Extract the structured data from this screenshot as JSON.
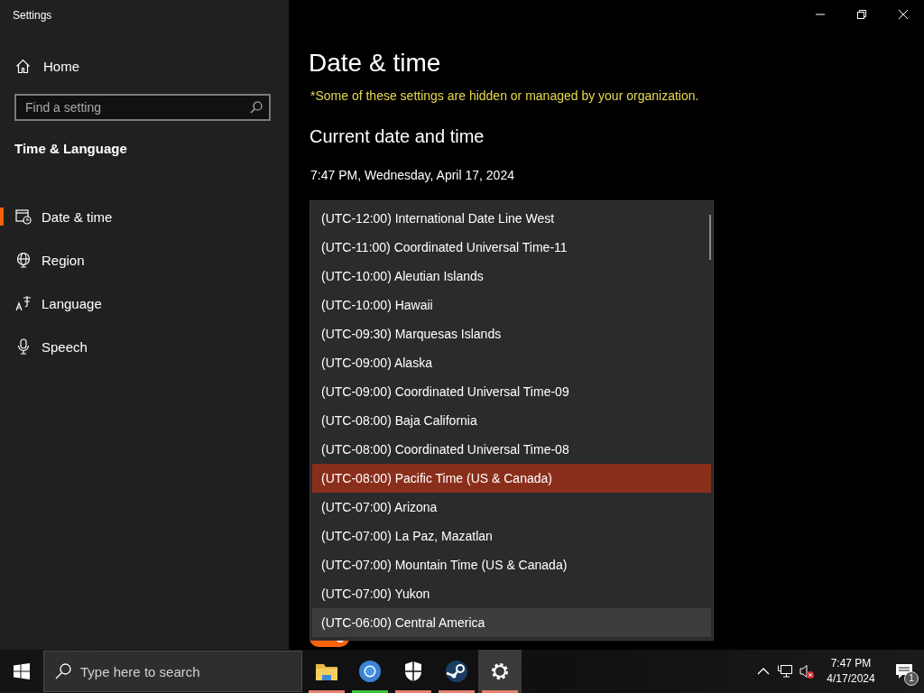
{
  "window": {
    "title": "Settings"
  },
  "sidebar": {
    "home": "Home",
    "search": {
      "placeholder": "Find a setting"
    },
    "section": "Time & Language",
    "items": [
      {
        "label": "Date & time",
        "kind": "calendar",
        "selected": true
      },
      {
        "label": "Region",
        "kind": "globe",
        "selected": false
      },
      {
        "label": "Language",
        "kind": "language",
        "selected": false
      },
      {
        "label": "Speech",
        "kind": "microphone",
        "selected": false
      }
    ]
  },
  "content": {
    "title": "Date & time",
    "notice": "*Some of these settings are hidden or managed by your organization.",
    "heading": "Current date and time",
    "datetime": "7:47 PM, Wednesday, April 17, 2024",
    "toggle": {
      "on": true
    }
  },
  "timezone_dropdown": {
    "options": [
      {
        "label": "(UTC-12:00) International Date Line West",
        "selected": false,
        "hovered": false
      },
      {
        "label": "(UTC-11:00) Coordinated Universal Time-11",
        "selected": false,
        "hovered": false
      },
      {
        "label": "(UTC-10:00) Aleutian Islands",
        "selected": false,
        "hovered": false
      },
      {
        "label": "(UTC-10:00) Hawaii",
        "selected": false,
        "hovered": false
      },
      {
        "label": "(UTC-09:30) Marquesas Islands",
        "selected": false,
        "hovered": false
      },
      {
        "label": "(UTC-09:00) Alaska",
        "selected": false,
        "hovered": false
      },
      {
        "label": "(UTC-09:00) Coordinated Universal Time-09",
        "selected": false,
        "hovered": false
      },
      {
        "label": "(UTC-08:00) Baja California",
        "selected": false,
        "hovered": false
      },
      {
        "label": "(UTC-08:00) Coordinated Universal Time-08",
        "selected": false,
        "hovered": false
      },
      {
        "label": "(UTC-08:00) Pacific Time (US & Canada)",
        "selected": true,
        "hovered": false
      },
      {
        "label": "(UTC-07:00) Arizona",
        "selected": false,
        "hovered": false
      },
      {
        "label": "(UTC-07:00) La Paz, Mazatlan",
        "selected": false,
        "hovered": false
      },
      {
        "label": "(UTC-07:00) Mountain Time (US & Canada)",
        "selected": false,
        "hovered": false
      },
      {
        "label": "(UTC-07:00) Yukon",
        "selected": false,
        "hovered": false
      },
      {
        "label": "(UTC-06:00) Central America",
        "selected": false,
        "hovered": true
      }
    ]
  },
  "taskbar": {
    "search": {
      "placeholder": "Type here to search"
    },
    "apps": [
      {
        "kind": "folder",
        "selected": false,
        "color": "#e8806e"
      },
      {
        "kind": "browser",
        "selected": false,
        "color": "#3ec23e"
      },
      {
        "kind": "shield",
        "selected": false,
        "color": "#e8806e"
      },
      {
        "kind": "steam",
        "selected": false,
        "color": "#e8806e"
      },
      {
        "kind": "gear",
        "selected": true,
        "color": "#e8806e"
      }
    ],
    "clock": {
      "time": "7:47 PM",
      "date": "4/17/2024"
    },
    "notifications": {
      "count": "1"
    }
  }
}
